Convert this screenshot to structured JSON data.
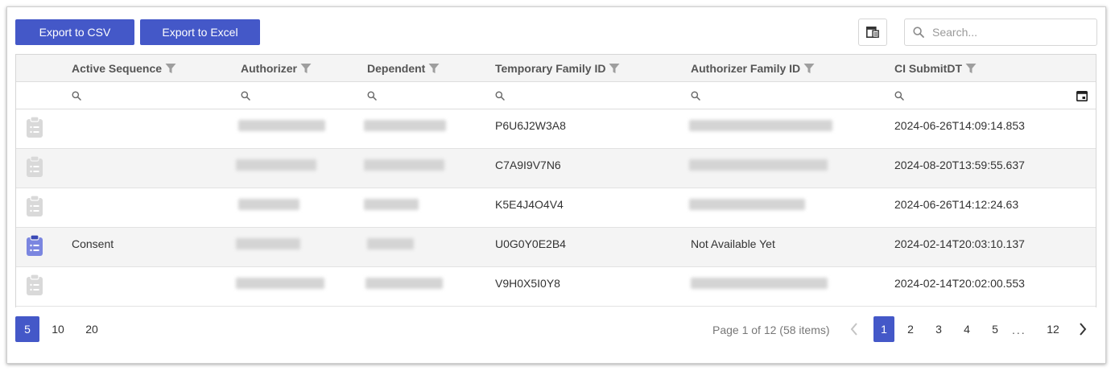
{
  "toolbar": {
    "export_csv_label": "Export to CSV",
    "export_excel_label": "Export to Excel",
    "search_placeholder": "Search..."
  },
  "columns": [
    {
      "label": "Active Sequence"
    },
    {
      "label": "Authorizer"
    },
    {
      "label": "Dependent"
    },
    {
      "label": "Temporary Family ID"
    },
    {
      "label": "Authorizer Family ID"
    },
    {
      "label": "CI SubmitDT"
    }
  ],
  "rows": [
    {
      "icon_active": false,
      "active_sequence": "",
      "temporary_family_id": "P6U6J2W3A8",
      "authorizer_family_id": "",
      "ci_submitdt": "2024-06-26T14:09:14.853"
    },
    {
      "icon_active": false,
      "active_sequence": "",
      "temporary_family_id": "C7A9I9V7N6",
      "authorizer_family_id": "",
      "ci_submitdt": "2024-08-20T13:59:55.637"
    },
    {
      "icon_active": false,
      "active_sequence": "",
      "temporary_family_id": "K5E4J4O4V4",
      "authorizer_family_id": "",
      "ci_submitdt": "2024-06-26T14:12:24.63"
    },
    {
      "icon_active": true,
      "active_sequence": "Consent",
      "temporary_family_id": "U0G0Y0E2B4",
      "authorizer_family_id": "Not Available Yet",
      "ci_submitdt": "2024-02-14T20:03:10.137"
    },
    {
      "icon_active": false,
      "active_sequence": "",
      "temporary_family_id": "V9H0X5I0Y8",
      "authorizer_family_id": "",
      "ci_submitdt": "2024-02-14T20:02:00.553"
    }
  ],
  "pager": {
    "page_sizes": [
      "5",
      "10",
      "20"
    ],
    "page_info": "Page 1 of 12 (58 items)",
    "pages": [
      "1",
      "2",
      "3",
      "4",
      "5",
      "12"
    ],
    "ellipsis": "..."
  },
  "colors": {
    "accent": "#4458c8",
    "header_bg": "#f4f4f4",
    "alt_row_bg": "#f4f4f4",
    "icon_muted": "#d9d9d9"
  },
  "icons": {
    "column_chooser": "column-chooser-icon",
    "search": "search-icon",
    "filter": "filter-funnel-icon",
    "calendar": "calendar-icon",
    "row": "clipboard-list-icon",
    "prev": "chevron-left-icon",
    "next": "chevron-right-icon"
  }
}
